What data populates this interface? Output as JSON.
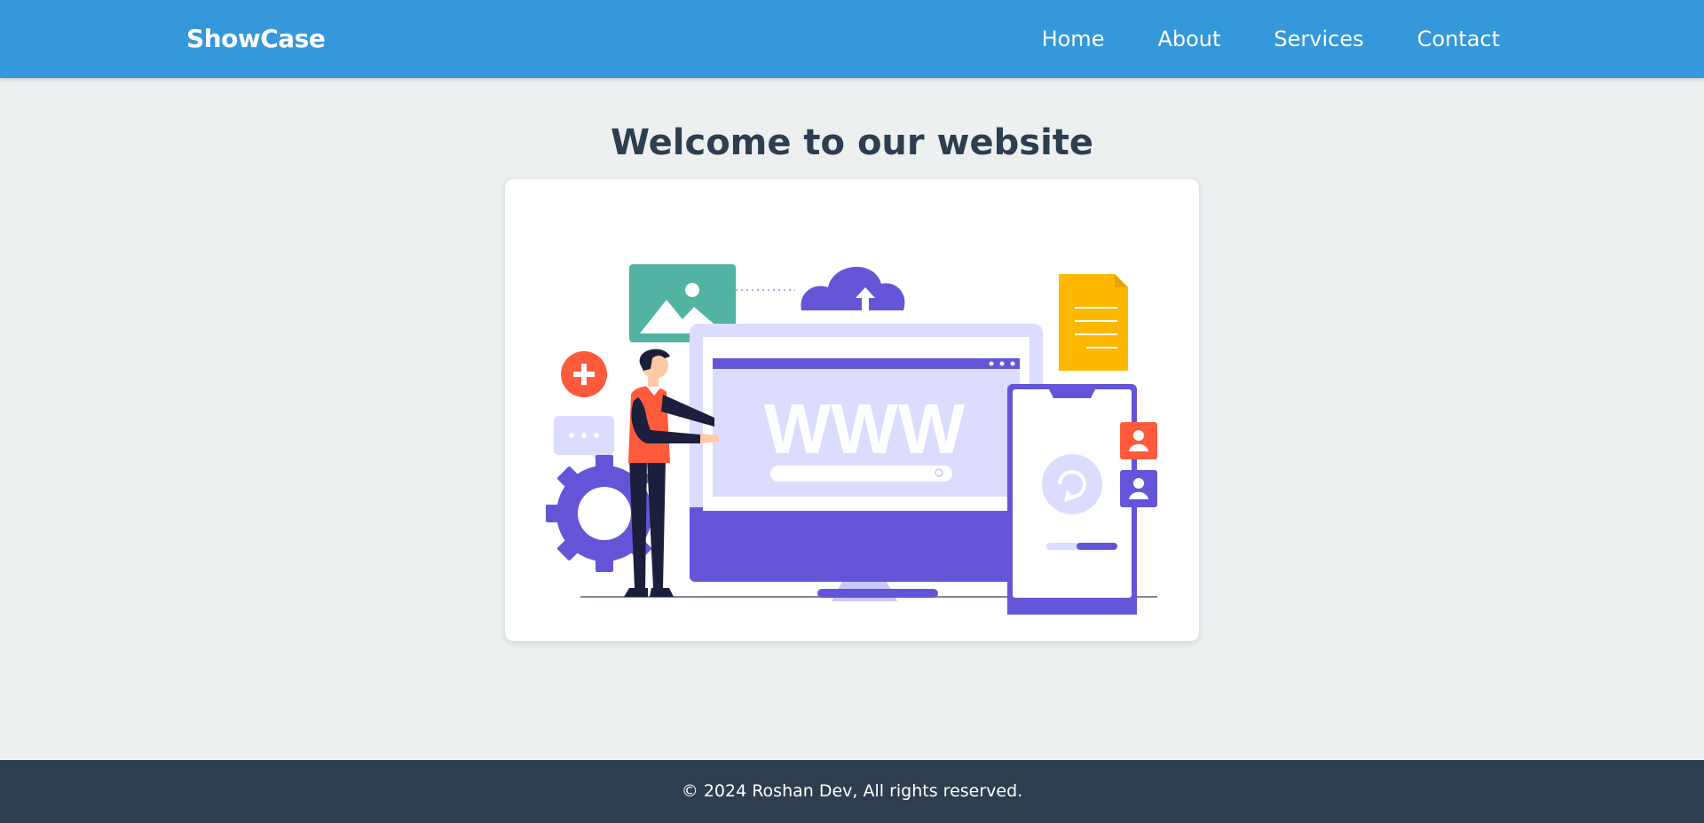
{
  "nav": {
    "brand": "ShowCase",
    "links": [
      "Home",
      "About",
      "Services",
      "Contact"
    ]
  },
  "main": {
    "heading": "Welcome to our website",
    "illustration": {
      "screen_text": "WWW",
      "icons": [
        "image-icon",
        "cloud-upload-icon",
        "document-icon",
        "plus-icon",
        "chat-bubble-icon",
        "gear-icon",
        "refresh-icon",
        "user-icon"
      ]
    }
  },
  "footer": {
    "copyright": "© 2024 Roshan Dev, All rights reserved."
  },
  "colors": {
    "navbar": "#3498db",
    "background": "#ecf0f1",
    "heading": "#2c3e50",
    "footer": "#2c3e50",
    "accent_purple": "#6455d8",
    "accent_teal": "#52b3a3",
    "accent_orange": "#ff5a3c",
    "accent_yellow": "#ffb800"
  }
}
